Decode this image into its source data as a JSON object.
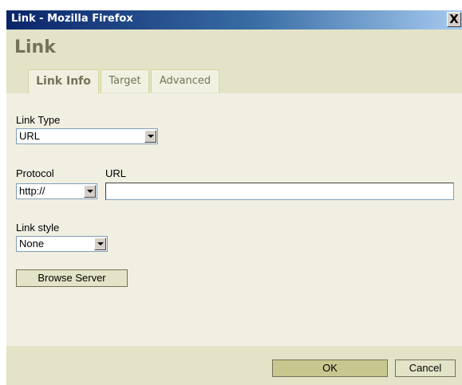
{
  "window": {
    "title": "Link - Mozilla Firefox",
    "close_label": "X"
  },
  "dialog": {
    "title": "Link"
  },
  "tabs": [
    {
      "label": "Link Info",
      "active": true
    },
    {
      "label": "Target",
      "active": false
    },
    {
      "label": "Advanced",
      "active": false
    }
  ],
  "form": {
    "link_type_label": "Link Type",
    "link_type_value": "URL",
    "protocol_label": "Protocol",
    "protocol_value": "http://",
    "url_label": "URL",
    "url_value": "",
    "link_style_label": "Link style",
    "link_style_value": "None",
    "browse_server_label": "Browse Server"
  },
  "footer": {
    "ok_label": "OK",
    "cancel_label": "Cancel"
  },
  "colors": {
    "titlebar_start": "#0a246a",
    "header_bg": "#e3e3c7",
    "body_bg": "#f1efe2",
    "title_text": "#737357"
  }
}
